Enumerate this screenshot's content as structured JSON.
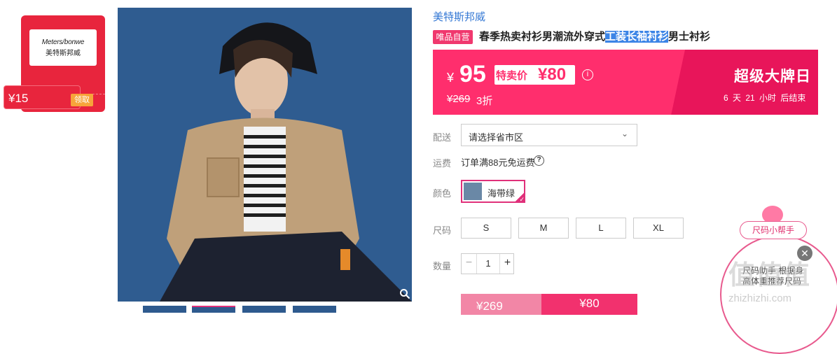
{
  "coupon": {
    "logo_line1": "Meters/bonwe",
    "logo_line2": "美特斯邦威",
    "amount": "¥15",
    "claim_label": "领取"
  },
  "product": {
    "brand": "美特斯邦威",
    "vip_tag": "唯品自营",
    "title_prefix": "春季热卖衬衫男潮流外穿式",
    "title_highlight": "工装长袖衬衫",
    "title_suffix": "男士衬衫"
  },
  "price": {
    "yen": "¥",
    "current": "95",
    "sale_label": "特卖价",
    "sale_price": "¥80",
    "info_icon": "i",
    "original": "¥269",
    "discount": "3折",
    "event_title": "超级大牌日",
    "countdown": "6 天 21 小时 后结束"
  },
  "delivery": {
    "label": "配送",
    "placeholder": "请选择省市区",
    "chevron": "⌄"
  },
  "shipping": {
    "label": "运费",
    "text": "订单满88元免运费",
    "help_icon": "?"
  },
  "color": {
    "label": "颜色",
    "options": [
      {
        "name": "海带绿",
        "selected": true
      }
    ]
  },
  "size": {
    "label": "尺码",
    "options": [
      "S",
      "M",
      "L",
      "XL"
    ]
  },
  "quantity": {
    "label": "数量",
    "value": "1",
    "minus": "−",
    "plus": "+"
  },
  "buy": {
    "left_price": "¥269",
    "right_price": "¥80"
  },
  "helper": {
    "bubble": "尺码小帮手",
    "text": "尺码助手 根据身高体重推荐尺码",
    "close": "✕"
  },
  "watermark": {
    "main": "值值值",
    "sub": "zhizhizhi.com"
  },
  "colors": {
    "accent": "#ff2e6d",
    "coupon_red": "#e8253d",
    "brand_blue": "#3478d4"
  }
}
